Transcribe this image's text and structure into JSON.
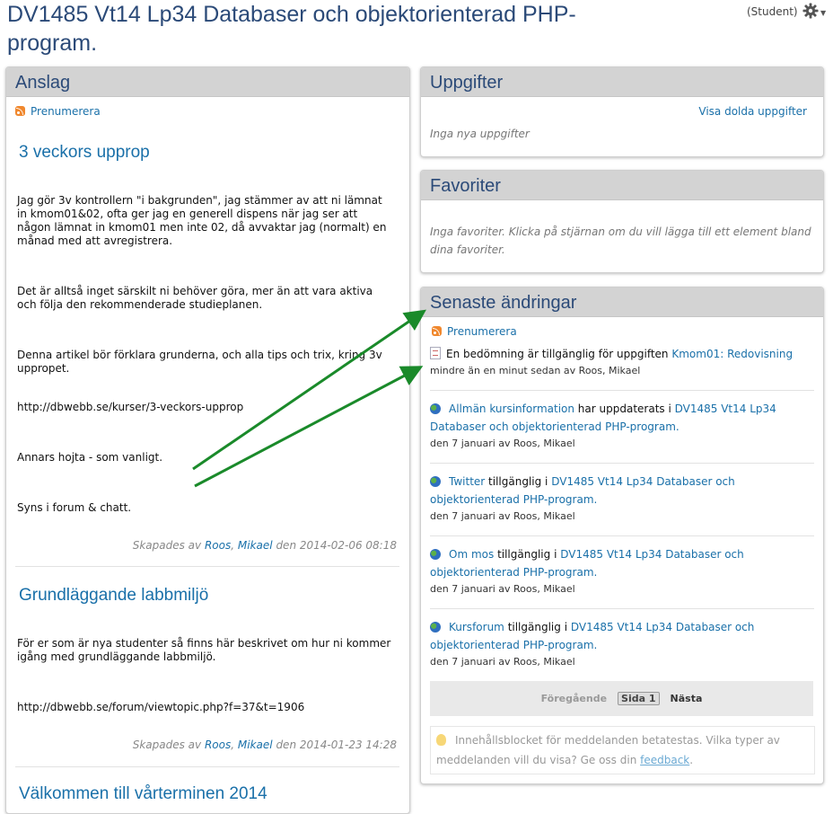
{
  "header": {
    "title": "DV1485 Vt14 Lp34 Databaser och objektorienterad PHP-program.",
    "role": "(Student)",
    "settings_icon": "gear-icon"
  },
  "anslag": {
    "title": "Anslag",
    "subscribe": "Prenumerera",
    "posts": [
      {
        "title": "3 veckors upprop",
        "paragraphs": [
          "Jag gör 3v kontrollern \"i bakgrunden\", jag stämmer av att ni lämnat in kmom01&02, ofta ger jag en generell dispens när jag ser att någon lämnat in kmom01 men inte 02, då avvaktar jag (normalt) en månad med att avregistrera.",
          "Det är alltså inget särskilt ni behöver göra, mer än att vara aktiva och följa den rekommenderade studieplanen.",
          "Denna artikel bör förklara grunderna, och alla tips och trix, kring 3v uppropet.",
          "http://dbwebb.se/kurser/3-veckors-upprop",
          "Annars hojta - som vanligt.",
          "Syns i forum & chatt."
        ],
        "meta_prefix": "Skapades av",
        "author_last": "Roos",
        "author_first": "Mikael",
        "meta_date": "den 2014-02-06 08:18"
      },
      {
        "title": "Grundläggande labbmiljö",
        "paragraphs": [
          "För er som är nya studenter så finns här beskrivet om hur ni kommer igång med grundläggande labbmiljö."
        ],
        "link": "http://dbwebb.se/forum/viewtopic.php?f=37&t=1906",
        "meta_prefix": "Skapades av",
        "author_last": "Roos",
        "author_first": "Mikael",
        "meta_date": "den 2014-01-23 14:28"
      },
      {
        "title": "Välkommen till vårterminen 2014"
      }
    ]
  },
  "uppgifter": {
    "title": "Uppgifter",
    "show_hidden": "Visa dolda uppgifter",
    "empty": "Inga nya uppgifter"
  },
  "favoriter": {
    "title": "Favoriter",
    "empty": "Inga favoriter. Klicka på stjärnan om du vill lägga till ett element bland dina favoriter."
  },
  "senaste": {
    "title": "Senaste ändringar",
    "subscribe": "Prenumerera",
    "first": {
      "text": "En bedömning är tillgänglig för uppgiften",
      "link": "Kmom01: Redovisning",
      "when": "mindre än en minut sedan av Roos, Mikael"
    },
    "items": [
      {
        "link": "Allmän kursinformation",
        "mid": "har uppdaterats i",
        "course": "DV1485 Vt14 Lp34 Databaser och objektorienterad PHP-program.",
        "when": "den 7 januari av Roos, Mikael"
      },
      {
        "link": "Twitter",
        "mid": "tillgänglig i",
        "course": "DV1485 Vt14 Lp34 Databaser och objektorienterad PHP-program.",
        "when": "den 7 januari av Roos, Mikael"
      },
      {
        "link": "Om mos",
        "mid": "tillgänglig i",
        "course": "DV1485 Vt14 Lp34 Databaser och objektorienterad PHP-program.",
        "when": "den 7 januari av Roos, Mikael"
      },
      {
        "link": "Kursforum",
        "mid": "tillgänglig i",
        "course": "DV1485 Vt14 Lp34 Databaser och objektorienterad PHP-program.",
        "when": "den 7 januari av Roos, Mikael"
      }
    ],
    "pager": {
      "prev": "Föregående",
      "current": "Sida 1",
      "next": "Nästa"
    },
    "notice": {
      "text": "Innehållsblocket för meddelanden betatestas. Vilka typer av meddelanden vill du visa? Ge oss din",
      "link": "feedback",
      "end": "."
    }
  },
  "colors": {
    "title": "#2b4a78",
    "link": "#1a70a9",
    "block_header": "#d3d3d3",
    "arrow": "#1a8a2a"
  }
}
